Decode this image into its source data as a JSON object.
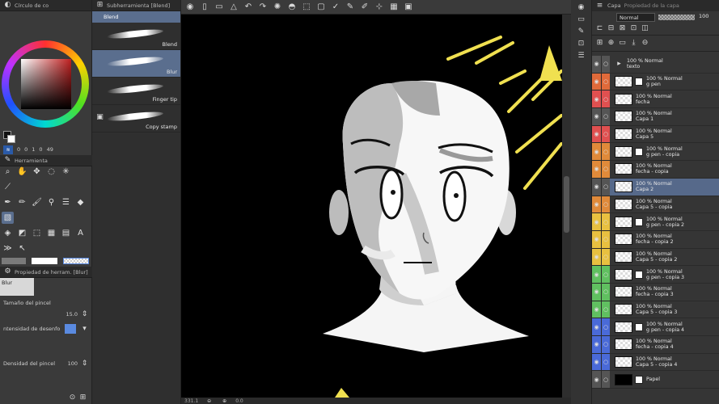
{
  "left": {
    "color_panel_title": "Círculo de co",
    "color_values": [
      "0",
      "0",
      "1",
      "0",
      "49"
    ],
    "tools_panel_title": "Herramienta",
    "tool_props_title": "Propiedad de herram. [Blur]",
    "tool_name": "Blur",
    "brush_size_label": "Tamaño del pincel",
    "brush_size_value": "15.0",
    "density_label": "ntensidad de desenfo",
    "brush_density_label": "Densidad del pincel",
    "brush_density_value": "100"
  },
  "subtool": {
    "title": "Subherramienta [Blend]",
    "items": [
      {
        "label": "Blend",
        "selected": false
      },
      {
        "label": "Blur",
        "selected": true
      },
      {
        "label": "Finger tip",
        "selected": false
      },
      {
        "label": "Copy stamp",
        "selected": false
      }
    ]
  },
  "status": {
    "zoom": "331.1",
    "angle": "0.0"
  },
  "layers": {
    "tab1": "Capa",
    "tab2": "Propiedad de la capa",
    "blend_mode": "Normal",
    "opacity": "100",
    "rows": [
      {
        "l1": "100 % Normal",
        "l2": "texto",
        "color": "#555555",
        "folder": true,
        "mask": false
      },
      {
        "l1": "100 % Normal",
        "l2": "g pen",
        "color": "#e06a3a",
        "folder": false,
        "mask": true
      },
      {
        "l1": "100 % Normal",
        "l2": "fecha",
        "color": "#e05050",
        "folder": false,
        "mask": false
      },
      {
        "l1": "100 % Normal",
        "l2": "Capa 1",
        "color": "#555555",
        "folder": false,
        "mask": false
      },
      {
        "l1": "100 % Normal",
        "l2": "Capa 5",
        "color": "#e05050",
        "folder": false,
        "mask": false
      },
      {
        "l1": "100 % Normal",
        "l2": "g pen - copia",
        "color": "#e08a3a",
        "folder": false,
        "mask": true
      },
      {
        "l1": "100 % Normal",
        "l2": "fecha - copia",
        "color": "#e08a3a",
        "folder": false,
        "mask": false
      },
      {
        "l1": "100 % Normal",
        "l2": "Capa 2",
        "color": "#555555",
        "folder": false,
        "mask": false,
        "selected": true
      },
      {
        "l1": "100 % Normal",
        "l2": "Capa 5 - copia",
        "color": "#e08a3a",
        "folder": false,
        "mask": false
      },
      {
        "l1": "100 % Normal",
        "l2": "g pen - copia 2",
        "color": "#e8c040",
        "folder": false,
        "mask": true
      },
      {
        "l1": "100 % Normal",
        "l2": "fecha - copia 2",
        "color": "#e8c040",
        "folder": false,
        "mask": false
      },
      {
        "l1": "100 % Normal",
        "l2": "Capa 5 - copia 2",
        "color": "#e8c040",
        "folder": false,
        "mask": false
      },
      {
        "l1": "100 % Normal",
        "l2": "g pen - copia 3",
        "color": "#60c060",
        "folder": false,
        "mask": true
      },
      {
        "l1": "100 % Normal",
        "l2": "fecha - copia 3",
        "color": "#60c060",
        "folder": false,
        "mask": false
      },
      {
        "l1": "100 % Normal",
        "l2": "Capa 5 - copia 3",
        "color": "#60c060",
        "folder": false,
        "mask": false
      },
      {
        "l1": "100 % Normal",
        "l2": "g pen - copia 4",
        "color": "#4a6ad8",
        "folder": false,
        "mask": true
      },
      {
        "l1": "100 % Normal",
        "l2": "fecha - copia 4",
        "color": "#4a6ad8",
        "folder": false,
        "mask": false
      },
      {
        "l1": "100 % Normal",
        "l2": "Capa 5 - copia 4",
        "color": "#4a6ad8",
        "folder": false,
        "mask": false
      },
      {
        "l1": "Papel",
        "l2": "",
        "color": "#555555",
        "folder": false,
        "mask": true,
        "paper": true
      }
    ]
  }
}
